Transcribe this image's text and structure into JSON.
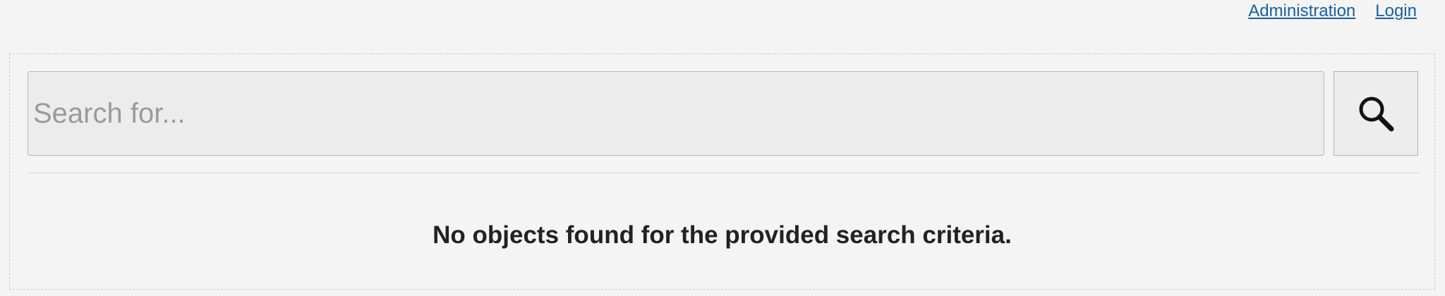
{
  "header": {
    "links": [
      {
        "label": "Administration"
      },
      {
        "label": "Login"
      }
    ]
  },
  "search": {
    "placeholder": "Search for...",
    "value": "",
    "button_icon": "search-icon"
  },
  "results": {
    "message": "No objects found for the provided search criteria."
  }
}
